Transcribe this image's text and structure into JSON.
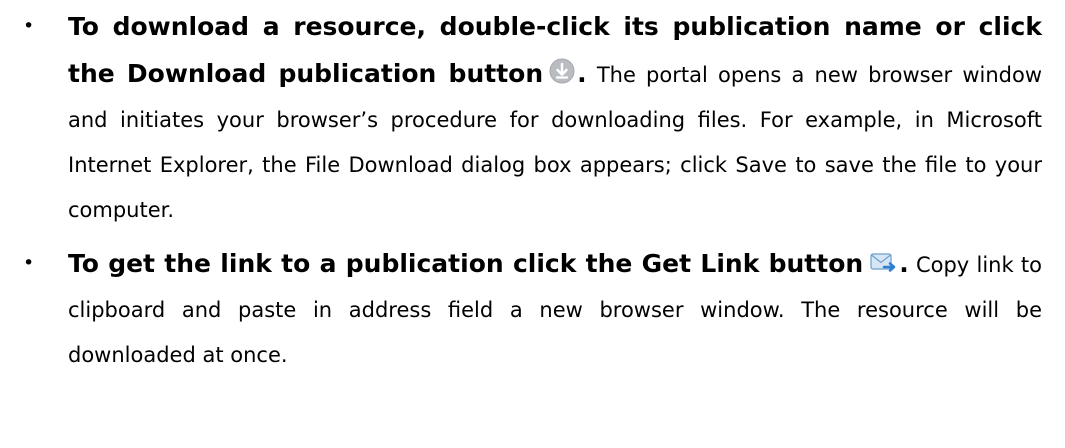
{
  "bullets": [
    {
      "lead_before_icon": "To download a resource, double-click its publication name or click the Download publication button",
      "lead_after_icon": ".",
      "body": " The portal opens a new browser window and initiates your browser’s procedure for downloading files. For example, in Microsoft Internet Explorer, the File Download dialog box appears; click Save to save the file to your computer.",
      "icon": "download-arrow-icon"
    },
    {
      "lead_before_icon": "To get the link to a publication click the Get Link button",
      "lead_after_icon": ".",
      "body": " Copy link to clipboard and paste in address field a new browser window. The resource will be downloaded at once.",
      "icon": "envelope-link-icon"
    }
  ],
  "bullet_glyph": "•",
  "colors": {
    "text": "#000000",
    "download_icon": "#b9bcc0",
    "envelope_icon_blue": "#4f97d9",
    "envelope_icon_body": "#d7e6f4"
  }
}
